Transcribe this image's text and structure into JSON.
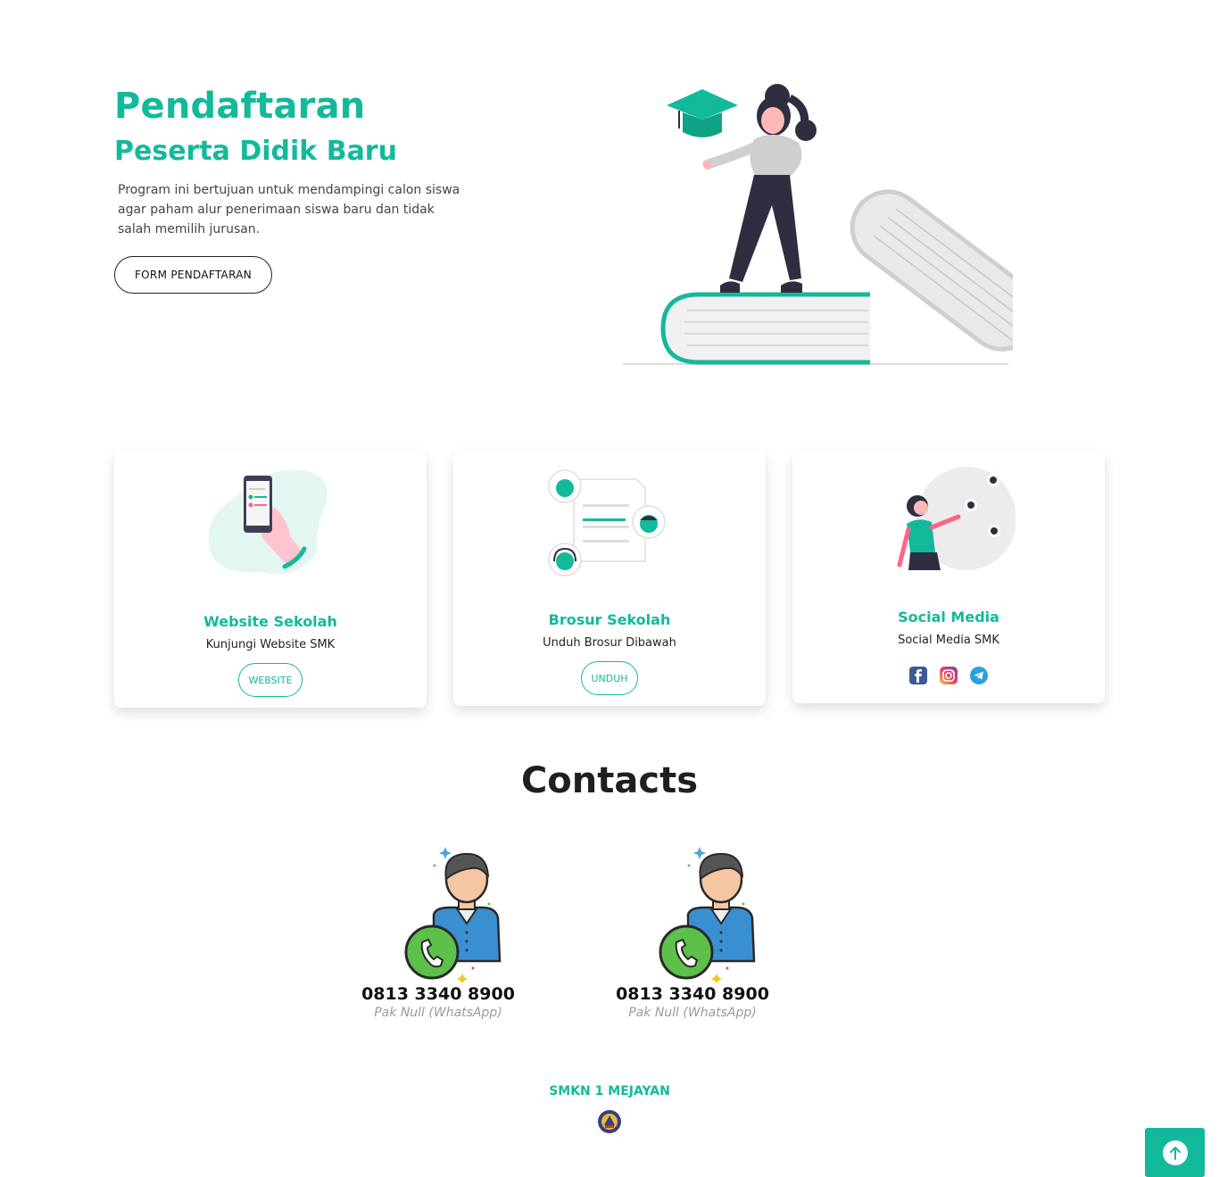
{
  "hero": {
    "title": "Pendaftaran",
    "subtitle": "Peserta Didik Baru",
    "description": "Program ini bertujuan untuk mendampingi calon siswa agar paham alur penerimaan siswa baru dan tidak salah memilih jurusan.",
    "form_button": "FORM PENDAFTARAN"
  },
  "cards": [
    {
      "title": "Website Sekolah",
      "text": "Kunjungi Website SMK",
      "button": "WEBSITE"
    },
    {
      "title": "Brosur Sekolah",
      "text": "Unduh Brosur Dibawah",
      "button": "UNDUH"
    },
    {
      "title": "Social Media",
      "text": "Social Media SMK",
      "icons": [
        "facebook-icon",
        "instagram-icon",
        "telegram-icon"
      ]
    }
  ],
  "contacts": {
    "title": "Contacts",
    "items": [
      {
        "phone": "0813 3340 8900",
        "name": "Pak Null (WhatsApp)"
      },
      {
        "phone": "0813 3340 8900",
        "name": "Pak Null (WhatsApp)"
      }
    ]
  },
  "footer": {
    "school_name": "SMKN 1 MEJAYAN"
  },
  "colors": {
    "accent": "#13b99b",
    "dark": "#2f2e41",
    "text": "#222222"
  }
}
